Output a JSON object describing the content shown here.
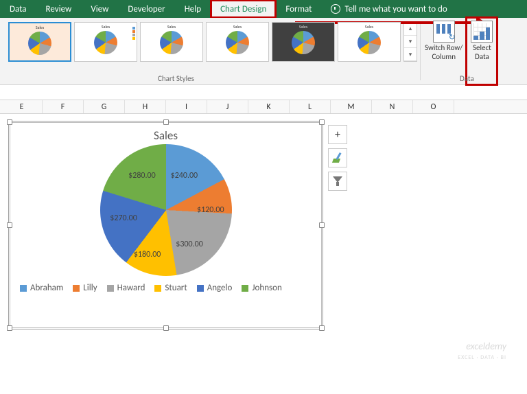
{
  "tabs": {
    "data": "Data",
    "review": "Review",
    "view": "View",
    "developer": "Developer",
    "help": "Help",
    "chart_design": "Chart Design",
    "format": "Format",
    "tell_me": "Tell me what you want to do"
  },
  "ribbon": {
    "styles_label": "Chart Styles",
    "data_label": "Data",
    "switch_row_col": "Switch Row/\nColumn",
    "select_data": "Select\nData",
    "thumb_title": "Sales"
  },
  "columns": [
    "E",
    "F",
    "G",
    "H",
    "I",
    "J",
    "K",
    "L",
    "M",
    "N",
    "O"
  ],
  "chart_data": {
    "type": "pie",
    "title": "Sales",
    "categories": [
      "Abraham",
      "Lilly",
      "Haward",
      "Stuart",
      "Angelo",
      "Johnson"
    ],
    "values": [
      240.0,
      120.0,
      300.0,
      180.0,
      270.0,
      280.0
    ],
    "data_labels": [
      "$240.00",
      "$120.00",
      "$300.00",
      "$180.00",
      "$270.00",
      "$280.00"
    ],
    "colors": [
      "#5b9bd5",
      "#ed7d31",
      "#a5a5a5",
      "#ffc000",
      "#4472c4",
      "#70ad47"
    ]
  },
  "side_buttons": {
    "add": "+",
    "styles": "brush",
    "filter": "filter"
  },
  "watermark": {
    "brand": "exceldemy",
    "tag": "EXCEL · DATA · BI"
  }
}
